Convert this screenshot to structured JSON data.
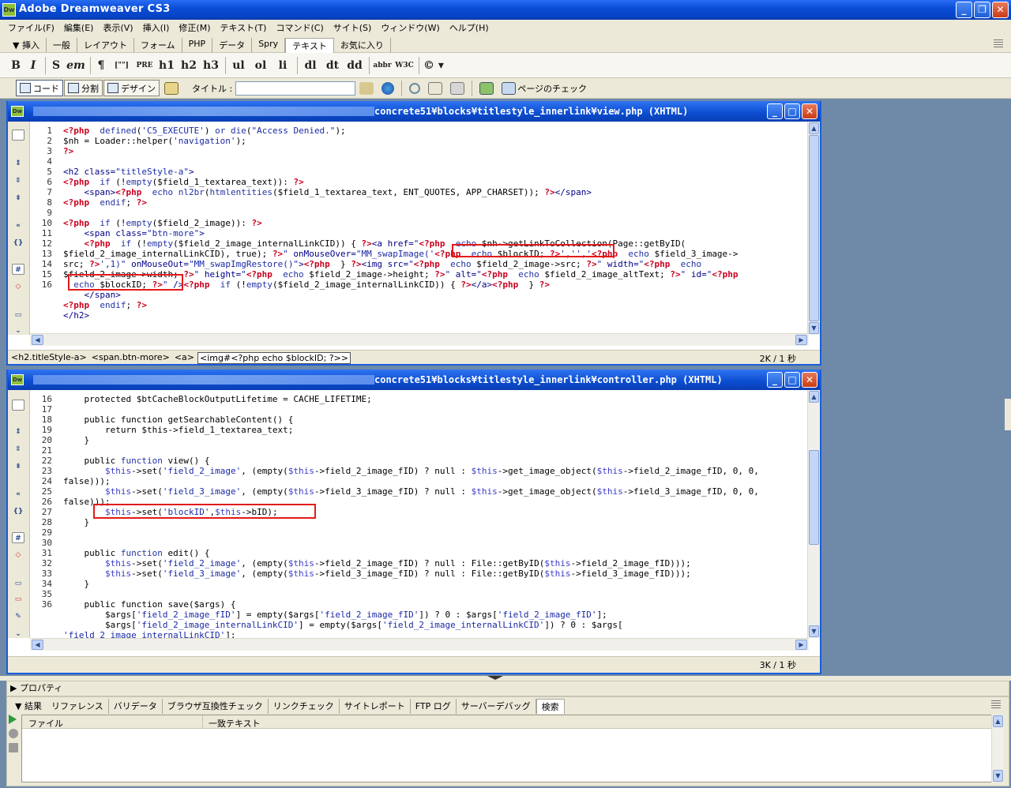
{
  "app": {
    "title": "Adobe Dreamweaver CS3",
    "icon_label": "Dw"
  },
  "menu": [
    "ファイル(F)",
    "編集(E)",
    "表示(V)",
    "挿入(I)",
    "修正(M)",
    "テキスト(T)",
    "コマンド(C)",
    "サイト(S)",
    "ウィンドウ(W)",
    "ヘルプ(H)"
  ],
  "insert_bar": {
    "label": "▼ 挿入",
    "tabs": [
      "一般",
      "レイアウト",
      "フォーム",
      "PHP",
      "データ",
      "Spry",
      "テキスト",
      "お気に入り"
    ],
    "active": "テキスト"
  },
  "text_toolbar": [
    "B",
    "I",
    "S",
    "em",
    "¶",
    "[\"\"]",
    "PRE",
    "h1",
    "h2",
    "h3",
    "ul",
    "ol",
    "li",
    "dl",
    "dt",
    "dd",
    "abbr",
    "W3C",
    "© ▾"
  ],
  "doc_toolbar": {
    "code_label": "コード",
    "split_label": "分割",
    "design_label": "デザイン",
    "title_label": "タイトル :",
    "title_value": "",
    "check_page_label": "ページのチェック"
  },
  "view_doc": {
    "path": "concrete51¥blocks¥titlestyle_innerlink¥view.php (XHTML)",
    "line_numbers": [
      "1",
      "2",
      "3",
      "4",
      "5",
      "6",
      "7",
      "8",
      "9",
      "10",
      "11",
      "12",
      "",
      "",
      "",
      "",
      "13",
      "14",
      "15",
      "16"
    ],
    "lines": [
      "<span class='pk'>&lt;?php</span>  <span class='kw'>defined</span>(<span class='st'>'C5_EXECUTE'</span>) <span class='kw'>or die</span>(<span class='st'>\"Access Denied.\"</span>);",
      "$nh = Loader::helper(<span class='st'>'navigation'</span>);",
      "<span class='pk'>?&gt;</span>",
      "",
      "<span class='tg'>&lt;h2 class=</span><span class='st'>\"titleStyle-a\"</span><span class='tg'>&gt;</span>",
      "<span class='pk'>&lt;?php</span>  <span class='kw'>if</span> (!<span class='kw'>empty</span>($field_1_textarea_text)): <span class='pk'>?&gt;</span>",
      "    <span class='tg'>&lt;span&gt;</span><span class='pk'>&lt;?php</span>  <span class='kw'>echo</span> <span class='kw'>nl2br</span>(<span class='kw'>htmlentities</span>($field_1_textarea_text, ENT_QUOTES, APP_CHARSET)); <span class='pk'>?&gt;</span><span class='tg'>&lt;/span&gt;</span>",
      "<span class='pk'>&lt;?php</span>  <span class='kw'>endif</span>; <span class='pk'>?&gt;</span>",
      "",
      "<span class='pk'>&lt;?php</span>  <span class='kw'>if</span> (!<span class='kw'>empty</span>($field_2_image)): <span class='pk'>?&gt;</span>",
      "    <span class='tg'>&lt;span class=</span><span class='st'>\"btn-more\"</span><span class='tg'>&gt;</span>",
      "    <span class='pk'>&lt;?php</span>  <span class='kw'>if</span> (!<span class='kw'>empty</span>($field_2_image_internalLinkCID)) { <span class='pk'>?&gt;</span><span class='tg'>&lt;a href=</span><span class='st'>\"</span><span class='pk'>&lt;?php</span>  <span class='kw'>echo</span> $nh-&gt;getLinkToCollection(Page::getByID(",
      "$field_2_image_internalLinkCID), true); <span class='pk'>?&gt;</span><span class='st'>\"</span> <span class='tg'>onMouseOver=</span><span class='st'>\"MM_swapImage('</span><span class='pk'>&lt;?php</span>  <span class='kw'>echo</span> $blockID; <span class='pk'>?&gt;</span><span class='st'>','','</span><span class='pk'>&lt;?php</span>  <span class='kw'>echo</span> $field_3_image-&gt;",
      "src; <span class='pk'>?&gt;</span><span class='st'>',1)\"</span> <span class='tg'>onMouseOut=</span><span class='st'>\"MM_swapImgRestore()\"</span><span class='tg'>&gt;</span><span class='pk'>&lt;?php</span>  } <span class='pk'>?&gt;</span><span class='tg'>&lt;img src=</span><span class='st'>\"</span><span class='pk'>&lt;?php</span>  <span class='kw'>echo</span> $field_2_image-&gt;src; <span class='pk'>?&gt;</span><span class='st'>\"</span> <span class='tg'>width=</span><span class='st'>\"</span><span class='pk'>&lt;?php</span>  <span class='kw'>echo</span>",
      "$field_2_image-&gt;width; <span class='pk'>?&gt;</span><span class='st'>\"</span> <span class='tg'>height=</span><span class='st'>\"</span><span class='pk'>&lt;?php</span>  <span class='kw'>echo</span> $field_2_image-&gt;height; <span class='pk'>?&gt;</span><span class='st'>\"</span> <span class='tg'>alt=</span><span class='st'>\"</span><span class='pk'>&lt;?php</span>  <span class='kw'>echo</span> $field_2_image_altText; <span class='pk'>?&gt;</span><span class='st'>\"</span> <span class='tg'>id=</span><span class='st'>\"</span><span class='pk'>&lt;?php</span>",
      "  <span class='kw'>echo</span> $blockID; <span class='pk'>?&gt;</span><span class='st'>\"</span> <span class='tg'>/&gt;</span><span class='pk'>&lt;?php</span>  <span class='kw'>if</span> (!<span class='kw'>empty</span>($field_2_image_internalLinkCID)) { <span class='pk'>?&gt;</span><span class='tg'>&lt;/a&gt;</span><span class='pk'>&lt;?php</span>  } <span class='pk'>?&gt;</span>",
      "    <span class='tg'>&lt;/span&gt;</span>",
      "<span class='pk'>&lt;?php</span>  <span class='kw'>endif</span>; <span class='pk'>?&gt;</span>",
      "<span class='tg'>&lt;/h2&gt;</span>",
      ""
    ],
    "status_tags": [
      "<h2.titleStyle-a>",
      "<span.btn-more>",
      "<a>",
      "<img#<?php  echo $blockID; ?>>"
    ],
    "status_size": "2K / 1 秒"
  },
  "controller_doc": {
    "path": "concrete51¥blocks¥titlestyle_innerlink¥controller.php (XHTML)",
    "line_numbers": [
      "16",
      "17",
      "18",
      "19",
      "20",
      "21",
      "22",
      "23",
      "",
      "24",
      "",
      "25",
      "26",
      "27",
      "28",
      "29",
      "30",
      "31",
      "32",
      "33",
      "34",
      "35",
      "36",
      ""
    ],
    "lines": [
      "    protected $btCacheBlockOutputLifetime = CACHE_LIFETIME;",
      "",
      "    public function getSearchableContent() {",
      "        return $this-&gt;field_1_textarea_text;",
      "    }",
      "",
      "    public <span class='kw'>function</span> view() {",
      "        <span class='vr'>$this</span>-&gt;set(<span class='st'>'field_2_image'</span>, (empty(<span class='vr'>$this</span>-&gt;field_2_image_fID) ? null : <span class='vr'>$this</span>-&gt;get_image_object(<span class='vr'>$this</span>-&gt;field_2_image_fID, 0, 0,",
      "false)));",
      "        <span class='vr'>$this</span>-&gt;set(<span class='st'>'field_3_image'</span>, (empty(<span class='vr'>$this</span>-&gt;field_3_image_fID) ? null : <span class='vr'>$this</span>-&gt;get_image_object(<span class='vr'>$this</span>-&gt;field_3_image_fID, 0, 0,",
      "false)));",
      "        <span class='vr'>$this</span>-&gt;set(<span class='st'>'blockID'</span>,<span class='vr'>$this</span>-&gt;bID);",
      "    }",
      "",
      "",
      "    public <span class='kw'>function</span> edit() {",
      "        <span class='vr'>$this</span>-&gt;set(<span class='st'>'field_2_image'</span>, (empty(<span class='vr'>$this</span>-&gt;field_2_image_fID) ? null : File::getByID(<span class='vr'>$this</span>-&gt;field_2_image_fID)));",
      "        <span class='vr'>$this</span>-&gt;set(<span class='st'>'field_3_image'</span>, (empty(<span class='vr'>$this</span>-&gt;field_3_image_fID) ? null : File::getByID(<span class='vr'>$this</span>-&gt;field_3_image_fID)));",
      "    }",
      "",
      "    public function save($args) {",
      "        $args[<span class='st'>'field_2_image_fID'</span>] = empty($args[<span class='st'>'field_2_image_fID'</span>]) ? 0 : $args[<span class='st'>'field_2_image_fID'</span>];",
      "        $args[<span class='st'>'field_2_image_internalLinkCID'</span>] = empty($args[<span class='st'>'field_2_image_internalLinkCID'</span>]) ? 0 : $args[",
      "<span class='st'>'field_2_image_internalLinkCID'</span>];"
    ],
    "status_size": "3K / 1 秒"
  },
  "properties_label": "▶ プロパティ",
  "results": {
    "label": "▼ 結果",
    "tabs": [
      "リファレンス",
      "バリデータ",
      "ブラウザ互換性チェック",
      "リンクチェック",
      "サイトレポート",
      "FTP ログ",
      "サーバーデバッグ",
      "検索"
    ],
    "active": "検索",
    "columns": [
      "ファイル",
      "一致テキスト"
    ]
  },
  "colors": {
    "titlebar": "#0a4ed8",
    "panel_bg": "#ece9d8",
    "php_tag": "#c8001e",
    "highlight_box": "#e41a1a"
  }
}
